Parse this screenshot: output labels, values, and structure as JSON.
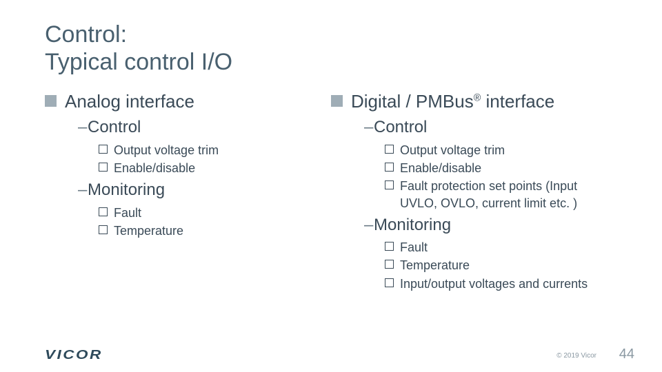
{
  "title_line1": "Control:",
  "title_line2": "Typical control I/O",
  "left": {
    "heading": "Analog interface",
    "group1": "Control",
    "group1_items": [
      "Output voltage trim",
      "Enable/disable"
    ],
    "group2": "Monitoring",
    "group2_items": [
      "Fault",
      "Temperature"
    ]
  },
  "right": {
    "heading_pre": "Digital / PMBus",
    "heading_sup": "®",
    "heading_post": " interface",
    "group1": "Control",
    "group1_items": [
      "Output voltage trim",
      "Enable/disable",
      "Fault protection set points (Input UVLO, OVLO, current limit etc. )"
    ],
    "group2": "Monitoring",
    "group2_items": [
      "Fault",
      "Temperature",
      "Input/output voltages and currents"
    ]
  },
  "footer": {
    "logo": "VICOR",
    "copyright": "© 2019 Vicor",
    "page": "44"
  }
}
